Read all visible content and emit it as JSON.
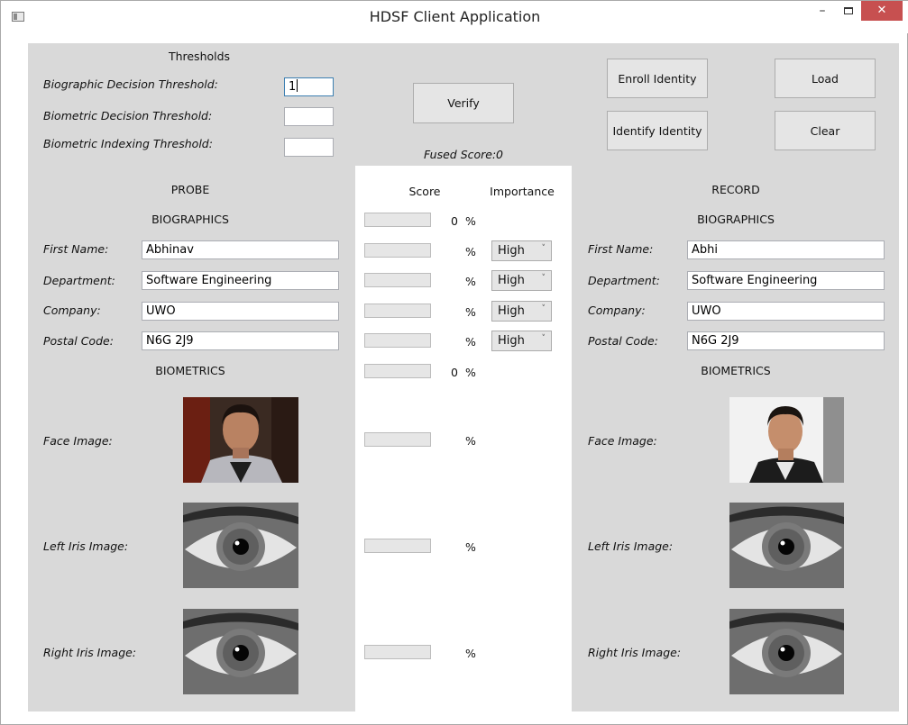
{
  "window": {
    "title": "HDSF Client Application",
    "min_glyph": "–",
    "close_glyph": "✕"
  },
  "thresholds": {
    "heading": "Thresholds",
    "biographic_label": "Biographic Decision Threshold:",
    "biographic_value": "1",
    "biometric_decision_label": "Biometric Decision Threshold:",
    "biometric_decision_value": "",
    "biometric_indexing_label": "Biometric Indexing Threshold:",
    "biometric_indexing_value": ""
  },
  "actions": {
    "verify": "Verify",
    "fused_score_label": "Fused Score:",
    "fused_score_value": "0",
    "enroll": "Enroll Identity",
    "identify": "Identify Identity",
    "load": "Load",
    "clear": "Clear"
  },
  "probe": {
    "heading": "PROBE",
    "biographics_heading": "BIOGRAPHICS",
    "biometrics_heading": "BIOMETRICS",
    "first_name_label": "First Name:",
    "first_name": "Abhinav",
    "department_label": "Department:",
    "department": "Software Engineering",
    "company_label": "Company:",
    "company": "UWO",
    "postal_label": "Postal Code:",
    "postal": "N6G 2J9",
    "face_label": "Face Image:",
    "left_iris_label": "Left Iris Image:",
    "right_iris_label": "Right Iris Image:"
  },
  "scores": {
    "score_heading": "Score",
    "importance_heading": "Importance",
    "biographic_total": "0",
    "biometric_total": "0",
    "percent": "%",
    "first_name_importance": "High",
    "department_importance": "High",
    "company_importance": "High",
    "postal_importance": "High"
  },
  "record": {
    "heading": "RECORD",
    "biographics_heading": "BIOGRAPHICS",
    "biometrics_heading": "BIOMETRICS",
    "first_name_label": "First Name:",
    "first_name": "Abhi",
    "department_label": "Department:",
    "department": "Software Engineering",
    "company_label": "Company:",
    "company": "UWO",
    "postal_label": "Postal Code:",
    "postal": "N6G 2J9",
    "face_label": "Face Image:",
    "left_iris_label": "Left Iris Image:",
    "right_iris_label": "Right Iris Image:"
  },
  "colors": {
    "panel_gray": "#d9d9d9",
    "close_red": "#c75050",
    "focus_blue": "#3c7fb1"
  }
}
